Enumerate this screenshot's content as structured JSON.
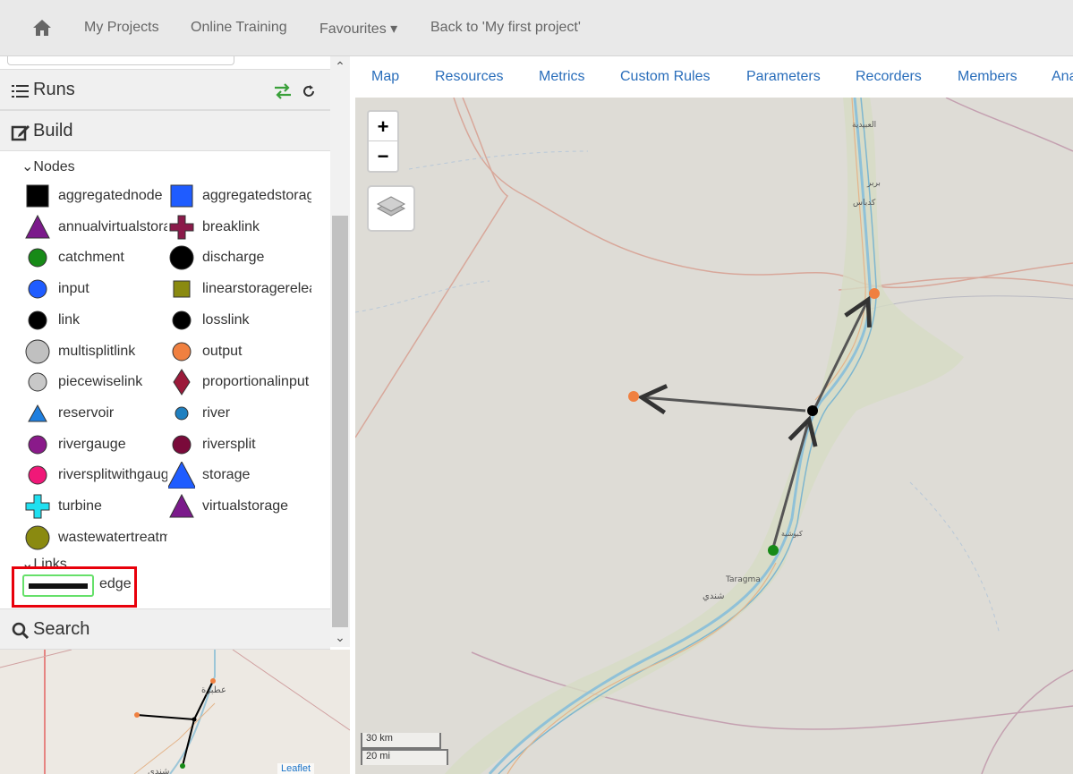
{
  "navbar": {
    "home_icon": "home-icon",
    "items": [
      "My Projects",
      "Online Training",
      "Favourites ▾",
      "Back to 'My first project'"
    ]
  },
  "runs": {
    "title": "Runs",
    "icons": [
      "list-icon",
      "swap-icon",
      "refresh-icon"
    ]
  },
  "build": {
    "title": "Build",
    "icon": "edit-icon"
  },
  "nodes": {
    "heading": "Nodes",
    "items": [
      {
        "label": "aggregatednode",
        "shape": "square",
        "color": "#000000"
      },
      {
        "label": "aggregatedstorage",
        "shape": "square",
        "color": "#1f5cff"
      },
      {
        "label": "annualvirtualstorage",
        "shape": "triangle",
        "color": "#7b1a8b"
      },
      {
        "label": "breaklink",
        "shape": "cross",
        "color": "#8b1a4a"
      },
      {
        "label": "catchment",
        "shape": "circle",
        "color": "#178a17"
      },
      {
        "label": "discharge",
        "shape": "circle-large",
        "color": "#000000"
      },
      {
        "label": "input",
        "shape": "circle",
        "color": "#1f5cff"
      },
      {
        "label": "linearstoragerelease",
        "shape": "square-small",
        "color": "#8a8a10"
      },
      {
        "label": "link",
        "shape": "circle",
        "color": "#000000"
      },
      {
        "label": "losslink",
        "shape": "circle",
        "color": "#000000"
      },
      {
        "label": "multisplitlink",
        "shape": "circle-large",
        "color": "#c0c0c0"
      },
      {
        "label": "output",
        "shape": "circle",
        "color": "#f08040"
      },
      {
        "label": "piecewiselink",
        "shape": "circle",
        "color": "#c8c8c8"
      },
      {
        "label": "proportionalinput",
        "shape": "diamond",
        "color": "#9b1a3a"
      },
      {
        "label": "reservoir",
        "shape": "triangle-small",
        "color": "#1f7fe0"
      },
      {
        "label": "river",
        "shape": "circle-small",
        "color": "#2080c0"
      },
      {
        "label": "rivergauge",
        "shape": "circle",
        "color": "#8a1a8a"
      },
      {
        "label": "riversplit",
        "shape": "circle",
        "color": "#7a0a3a"
      },
      {
        "label": "riversplitwithgauge",
        "shape": "circle",
        "color": "#f01878"
      },
      {
        "label": "storage",
        "shape": "triangle-large",
        "color": "#1f5cff"
      },
      {
        "label": "turbine",
        "shape": "cross",
        "color": "#20e0f0"
      },
      {
        "label": "virtualstorage",
        "shape": "triangle",
        "color": "#7b1a8b"
      },
      {
        "label": "wastewatertreatment",
        "shape": "circle-large",
        "color": "#8a8a10"
      }
    ]
  },
  "links": {
    "heading": "Links",
    "items": [
      {
        "label": "edge"
      }
    ]
  },
  "search": {
    "title": "Search",
    "icon": "search-icon"
  },
  "minimap": {
    "attribution": "Leaflet",
    "place_labels": [
      "عطبرة",
      "شندي"
    ]
  },
  "tabs": [
    "Map",
    "Resources",
    "Metrics",
    "Custom Rules",
    "Parameters",
    "Recorders",
    "Members",
    "Ana"
  ],
  "map": {
    "zoom_in": "+",
    "zoom_out": "−",
    "layers_icon": "layers-icon",
    "scale_km": "30 km",
    "scale_mi": "20 mi",
    "place_labels": [
      "العبيدية",
      "بربر",
      "كدباس",
      "Taragma",
      "شندي",
      "كبوشية"
    ]
  },
  "accent_colors": {
    "tab_link": "#2a6ebb",
    "highlight": "#e8000b",
    "refresh": "#3aa03a"
  }
}
